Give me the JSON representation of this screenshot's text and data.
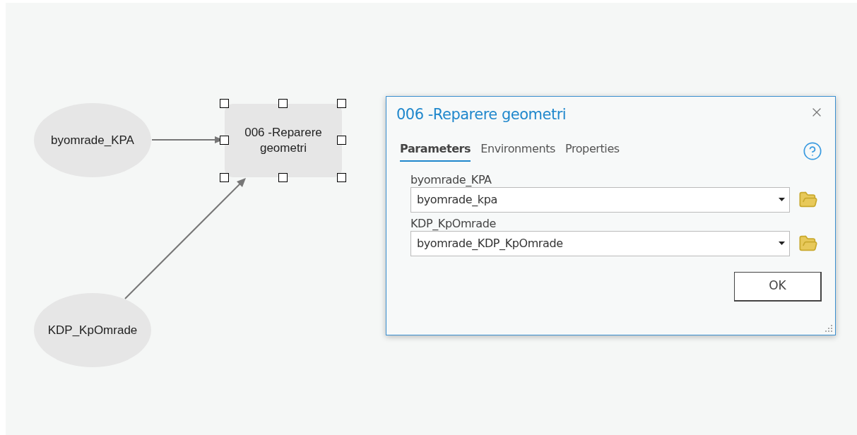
{
  "diagram": {
    "nodes": [
      {
        "kind": "data",
        "label": "byomrade_KPA"
      },
      {
        "kind": "data",
        "label": "KDP_KpOmrade"
      },
      {
        "kind": "tool",
        "label": "006 -Reparere geometri",
        "selected": true
      }
    ]
  },
  "dialog": {
    "title": "006 -Reparere geometri",
    "tabs": [
      {
        "label": "Parameters",
        "selected": true
      },
      {
        "label": "Environments",
        "selected": false
      },
      {
        "label": "Properties",
        "selected": false
      }
    ],
    "parameters": [
      {
        "label": "byomrade_KPA",
        "value": "byomrade_kpa"
      },
      {
        "label": "KDP_KpOmrade",
        "value": "byomrade_KDP_KpOmrade"
      }
    ],
    "buttons": [
      "OK"
    ]
  }
}
